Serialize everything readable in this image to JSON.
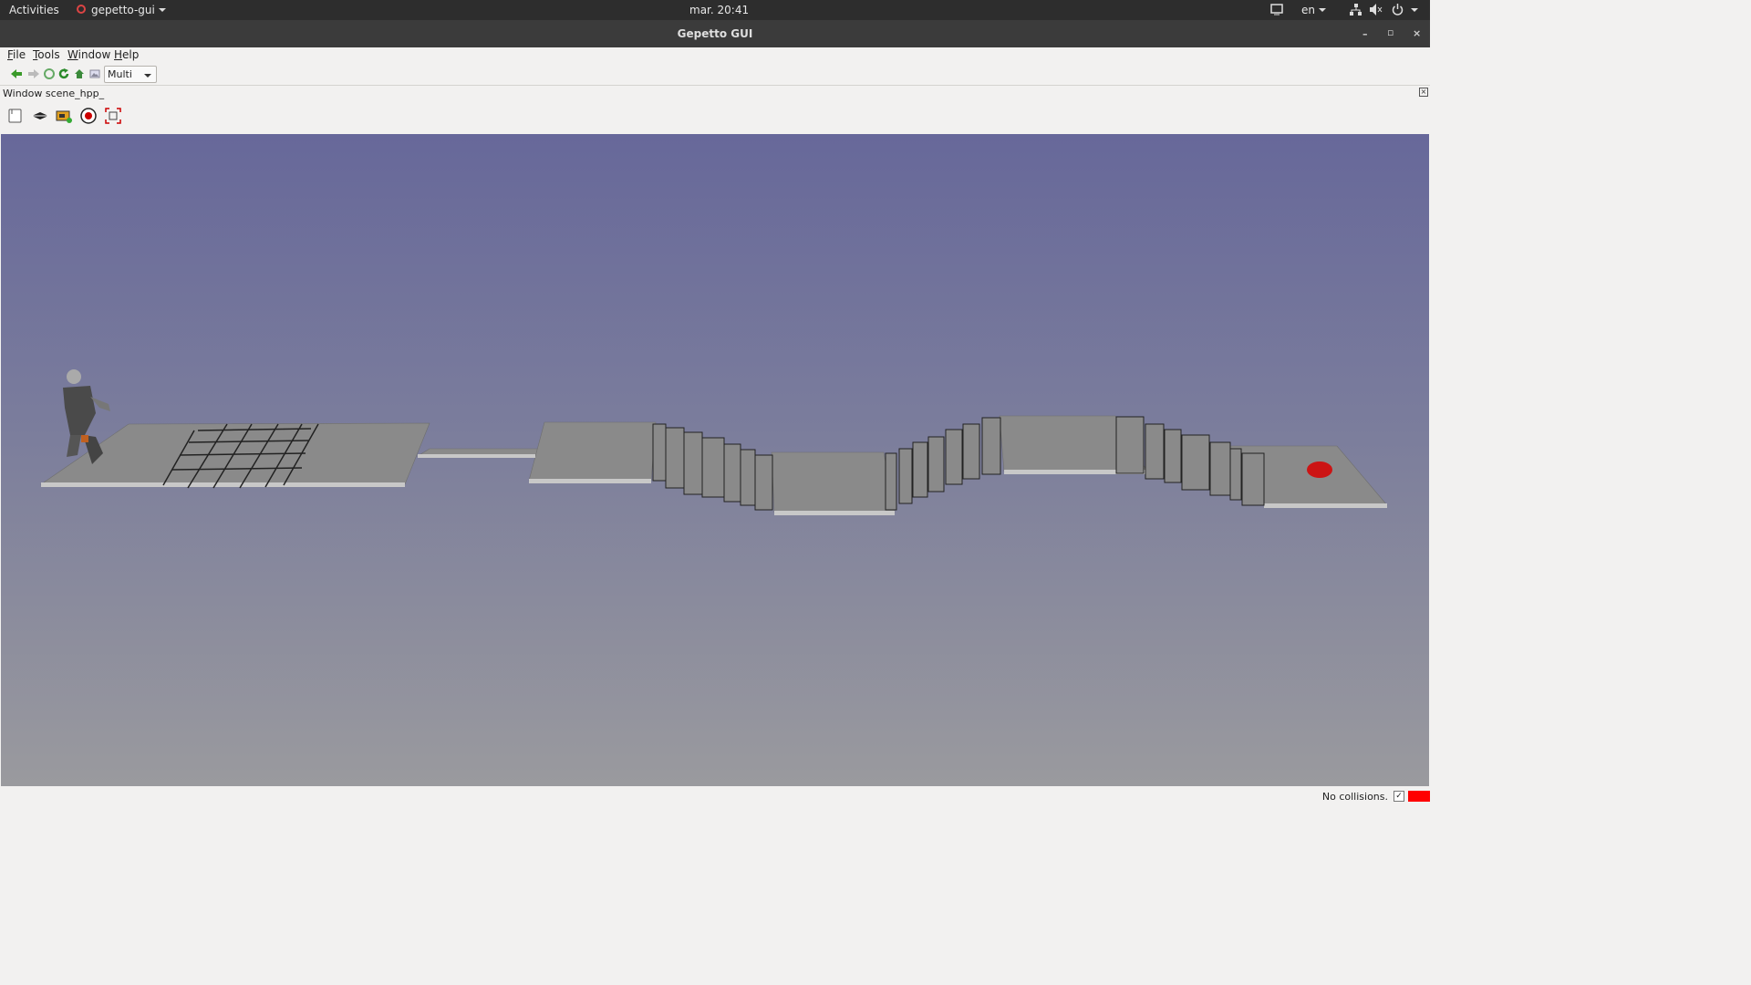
{
  "system_bar": {
    "activities": "Activities",
    "app_menu": "gepetto-gui",
    "clock": "mar. 20:41",
    "language": "en"
  },
  "window": {
    "title": "Gepetto GUI"
  },
  "menu": [
    "File",
    "Tools",
    "Window",
    "Help"
  ],
  "toolbar": {
    "mode_select": "Multi",
    "icons": [
      "back-arrow-icon",
      "forward-arrow-icon",
      "stop-icon",
      "refresh-icon",
      "home-icon",
      "image-icon"
    ]
  },
  "dock": {
    "title": "Window scene_hpp_",
    "tools": [
      "camera-icon",
      "plane-icon",
      "screenshot-icon",
      "record-icon",
      "fullscreen-icon"
    ]
  },
  "viewport": {
    "background_top": "#67689a",
    "background_bottom": "#9a9a9e",
    "floor_color": "#8a8a8a",
    "target_color": "#cc1414"
  },
  "status": {
    "text": "No collisions.",
    "checkbox_mark": "✓",
    "indicator_color": "#ff0000"
  }
}
